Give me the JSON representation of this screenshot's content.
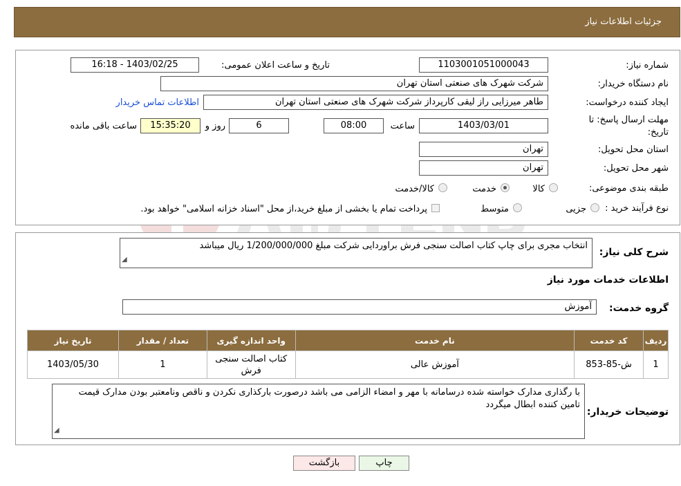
{
  "header": {
    "title": "جزئیات اطلاعات نیاز"
  },
  "info": {
    "need_number_label": "شماره نیاز:",
    "need_number": "1103001051000043",
    "announce_label": "تاریخ و ساعت اعلان عمومی:",
    "announce_value": "1403/02/25 - 16:18",
    "buyer_org_label": "نام دستگاه خریدار:",
    "buyer_org": "شرکت شهرک های صنعتی استان تهران",
    "creator_label": "ایجاد کننده درخواست:",
    "creator": "طاهر  میرزایی راز لیقی کارپرداز شرکت شهرک های صنعتی استان تهران",
    "contact_link": "اطلاعات تماس خریدار",
    "deadline_label_1": "مهلت ارسال پاسخ: تا",
    "deadline_label_2": "تاریخ:",
    "deadline_date": "1403/03/01",
    "time_label": "ساعت",
    "deadline_time": "08:00",
    "days": "6",
    "days_label": "روز و",
    "remaining": "15:35:20",
    "remaining_label": "ساعت باقی مانده",
    "province_label": "استان محل تحویل:",
    "province": "تهران",
    "city_label": "شهر محل تحویل:",
    "city": "تهران",
    "category_label": "طبقه بندی موضوعی:",
    "category_options": [
      "کالا",
      "خدمت",
      "کالا/خدمت"
    ],
    "category_selected": "خدمت",
    "process_label": "نوع فرآیند خرید :",
    "process_options": [
      "جزیی",
      "متوسط"
    ],
    "payment_note": "پرداخت تمام یا بخشی از مبلغ خرید،از محل \"اسناد خزانه اسلامی\" خواهد بود."
  },
  "description": {
    "label": "شرح کلی نیاز:",
    "value": "انتخاب مجری برای چاپ کتاب اصالت سنجی فرش براوردایی شرکت مبلغ 1/200/000/000 ریال میباشد"
  },
  "services": {
    "section_title": "اطلاعات خدمات مورد نیاز",
    "group_label": "گروه خدمت:",
    "group_value": "آموزش",
    "columns": [
      "ردیف",
      "کد خدمت",
      "نام خدمت",
      "واحد اندازه گیری",
      "تعداد / مقدار",
      "تاریخ نیاز"
    ],
    "rows": [
      {
        "row": "1",
        "code": "ش-85-853",
        "name": "آموزش عالی",
        "unit": "کتاب اصالت سنجی فرش",
        "qty": "1",
        "date": "1403/05/30"
      }
    ]
  },
  "buyer_notes": {
    "label": "توضیحات خریدار:",
    "value": "با رگذاری مدارک خواسته شده  درسامانه با مهر و امضاء الزامی می باشد درصورت بارکذاری نکردن و ناقص ونامعتبر بودن مدارک قیمت تامین کننده ابطال میگردد"
  },
  "buttons": {
    "print": "چاپ",
    "back": "بازگشت"
  },
  "colors": {
    "header_bg": "#8c6d3f",
    "remaining_bg": "#ffffcc",
    "print_bg": "#eaf7e6",
    "back_bg": "#fde8e8",
    "link": "#1a4fd6"
  }
}
